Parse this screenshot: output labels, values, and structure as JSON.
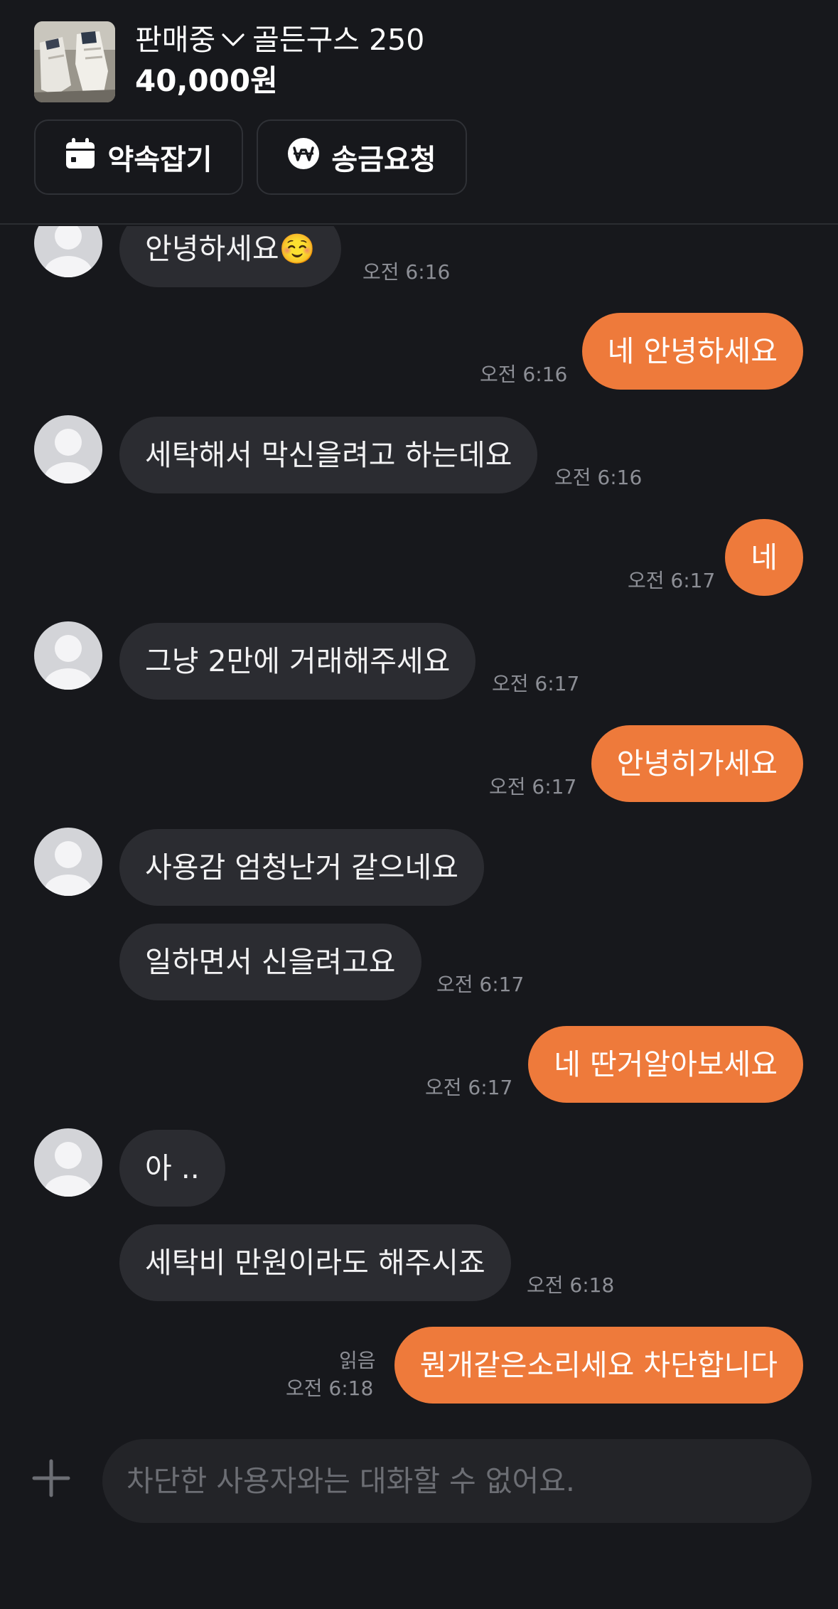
{
  "product": {
    "status": "판매중",
    "title": "골든구스 250",
    "price": "40,000원"
  },
  "actions": {
    "appointment_label": "약속잡기",
    "remit_label": "송금요청"
  },
  "messages": [
    {
      "side": "in",
      "text": "안녕하세요☺️",
      "time": "오전 6:16"
    },
    {
      "side": "out",
      "text": "네 안녕하세요",
      "time": "오전 6:16"
    },
    {
      "side": "in",
      "text": "세탁해서 막신을려고 하는데요",
      "time": "오전 6:16"
    },
    {
      "side": "out",
      "text": "네",
      "time": "오전 6:17"
    },
    {
      "side": "in",
      "text": "그냥 2만에 거래해주세요",
      "time": "오전 6:17"
    },
    {
      "side": "out",
      "text": "안녕히가세요",
      "time": "오전 6:17"
    },
    {
      "side": "in",
      "text": "사용감 엄청난거 같으네요",
      "time": ""
    },
    {
      "side": "in",
      "text": "일하면서 신을려고요",
      "time": "오전 6:17"
    },
    {
      "side": "out",
      "text": "네 딴거알아보세요",
      "time": "오전 6:17"
    },
    {
      "side": "in",
      "text": "아 ..",
      "time": ""
    },
    {
      "side": "in",
      "text": "세탁비 만원이라도 해주시죠",
      "time": "오전 6:18"
    },
    {
      "side": "out",
      "text": "뭔개같은소리세요 차단합니다",
      "time": "오전 6:18",
      "read": "읽음"
    }
  ],
  "composer": {
    "placeholder": "차단한 사용자와는 대화할 수 없어요."
  },
  "colors": {
    "background": "#17181c",
    "incoming_bubble": "#2b2c31",
    "outgoing_bubble": "#ee7a3b",
    "timestamp": "#8d8f96"
  }
}
